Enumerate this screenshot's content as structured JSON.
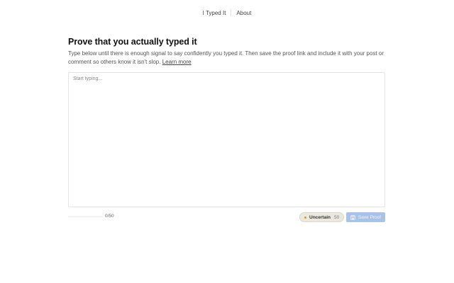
{
  "nav": {
    "brand": "I Typed It",
    "about": "About"
  },
  "main": {
    "title": "Prove that you actually typed it",
    "description": "Type below until there is enough signal to say confidently you typed it. Then save the proof link and include it with your post or comment so others know it isn't slop.",
    "learn_more": "Learn more"
  },
  "editor": {
    "placeholder": "Start typing...",
    "value": ""
  },
  "footer": {
    "progress_fraction": 0,
    "counter": "0/50",
    "status_badge": {
      "label": "Uncertain",
      "score": "50",
      "dot_color": "#d4a017"
    },
    "save_button": {
      "label": "Save Proof",
      "icon": "save-icon",
      "disabled": true
    }
  },
  "colors": {
    "accent_disabled": "#a9c3e8"
  }
}
